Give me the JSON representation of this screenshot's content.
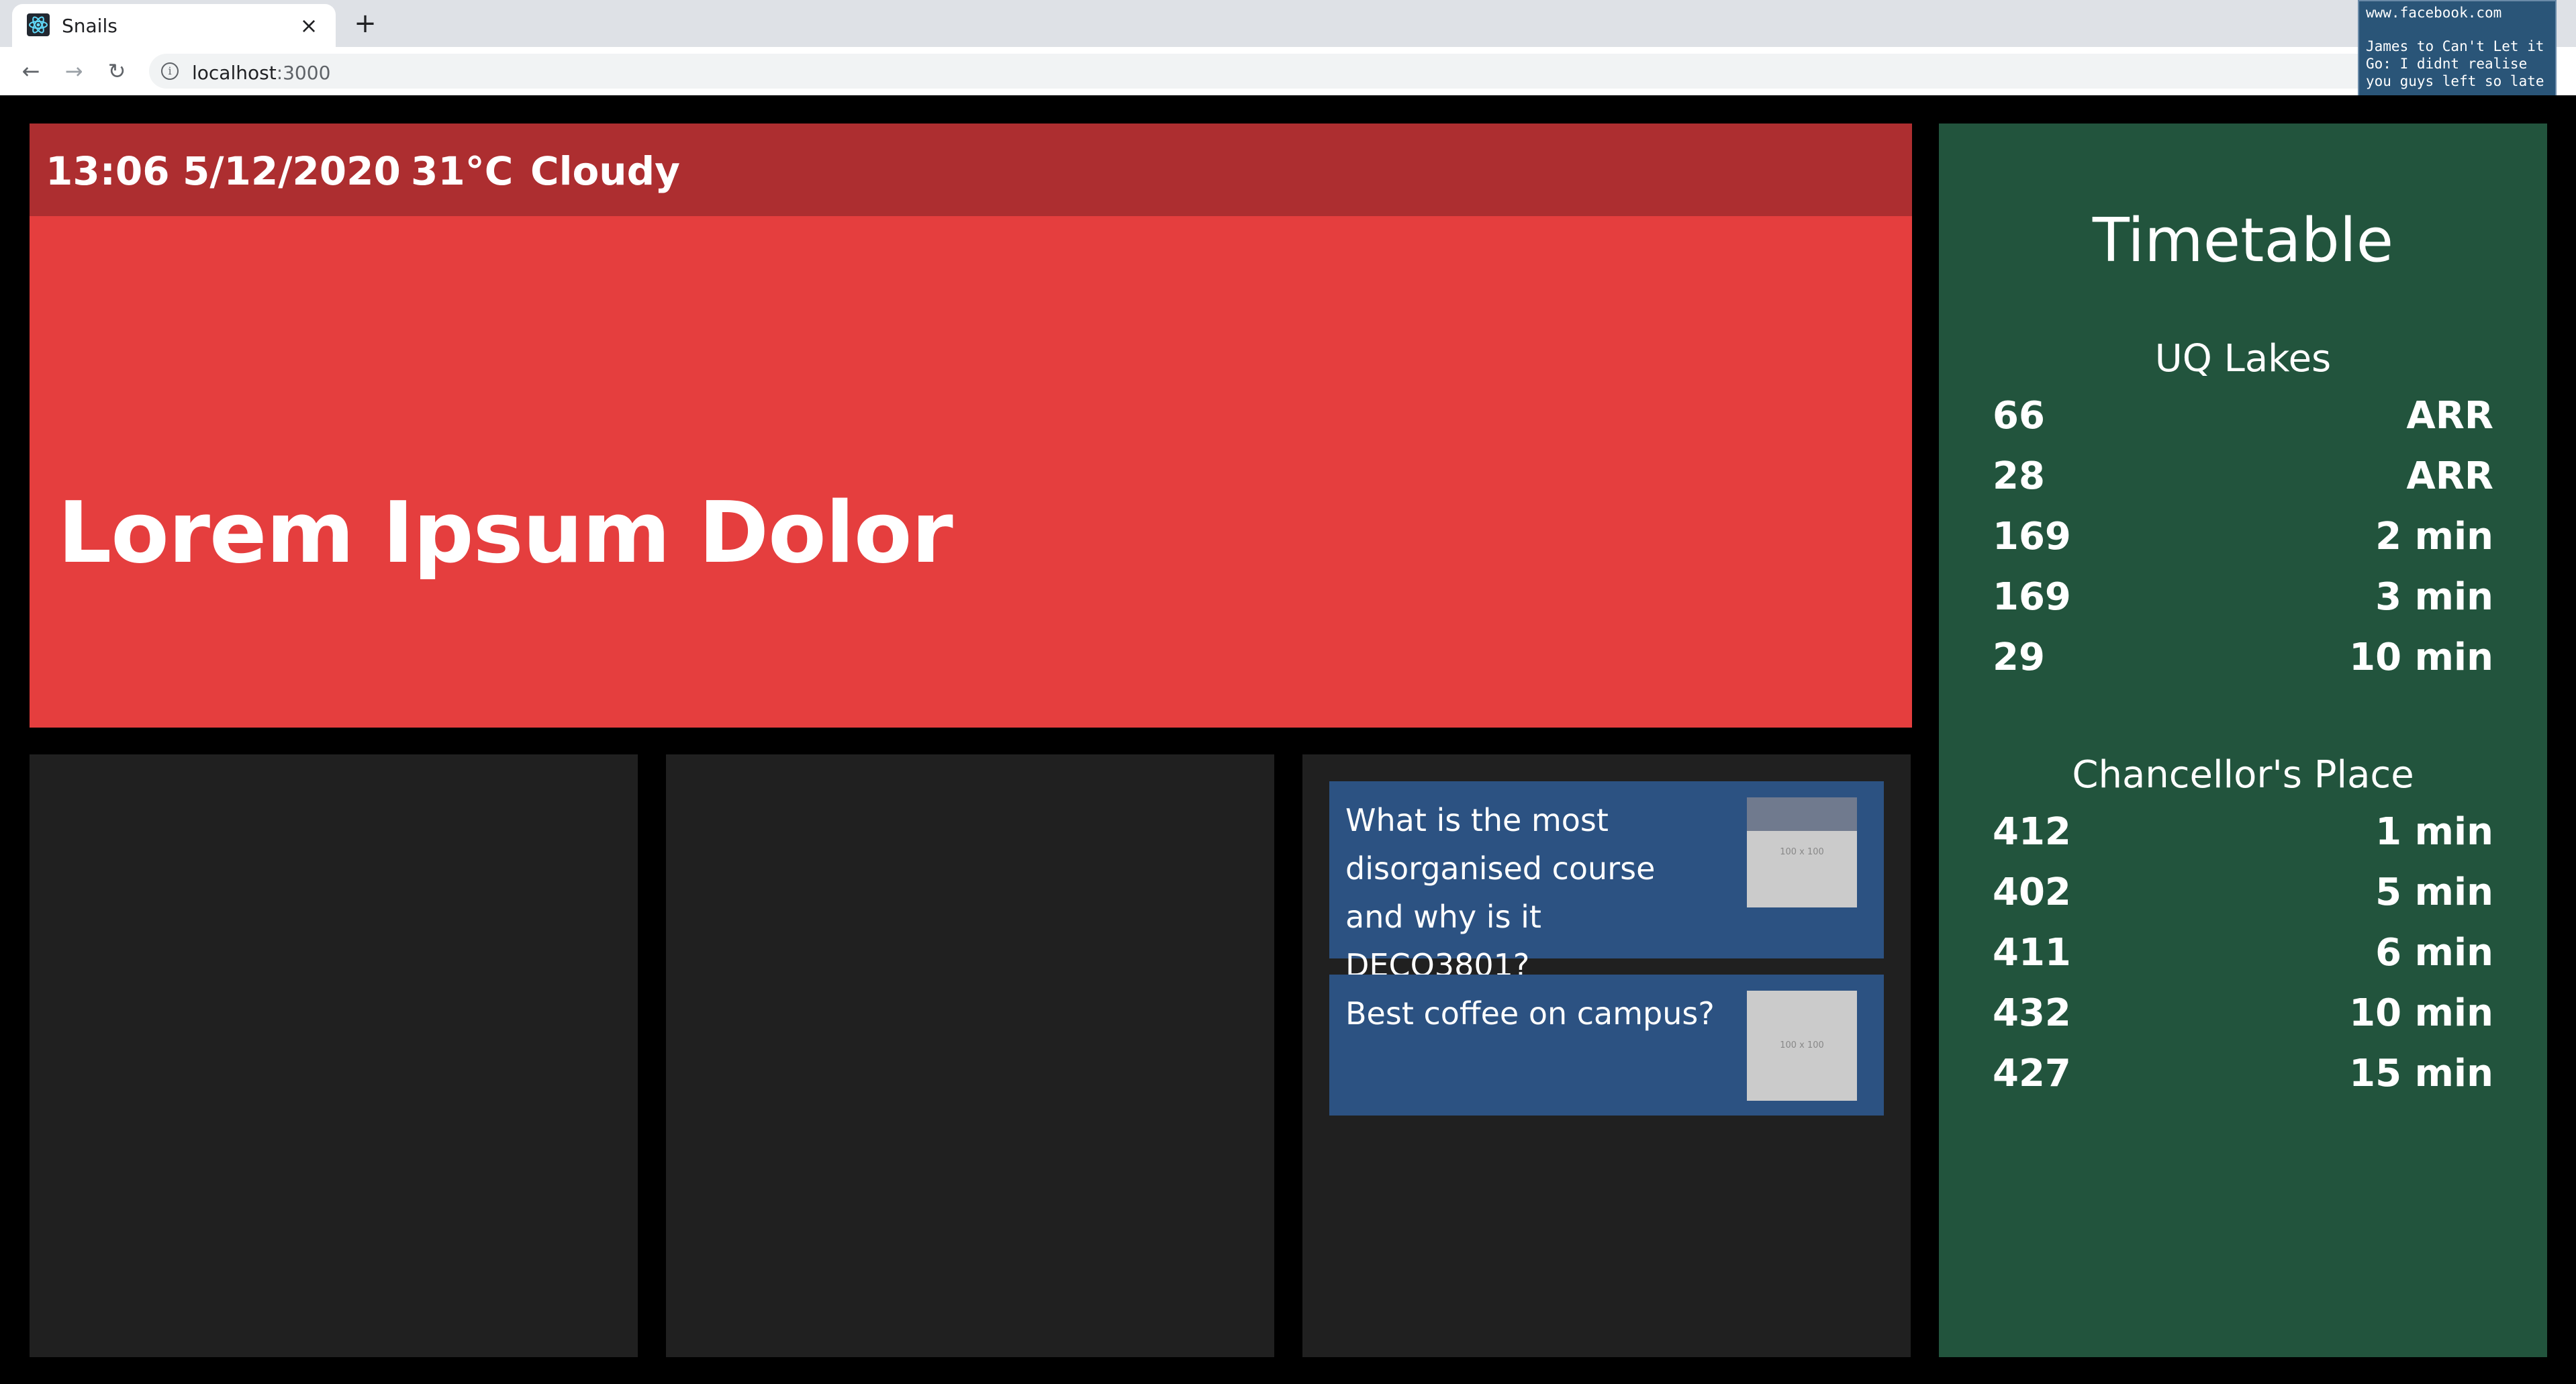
{
  "browser": {
    "tab_title": "Snails",
    "tab_close": "×",
    "new_tab": "+",
    "back": "←",
    "forward": "→",
    "reload": "↻",
    "info": "i",
    "url_host": "localhost",
    "url_port": ":3000"
  },
  "notification": {
    "title": "www.facebook.com",
    "body": "James to Can't Let it Go: I didnt realise you guys left so late"
  },
  "hero": {
    "time": "13:06",
    "date": "5/12/2020",
    "temperature": "31°C",
    "weather": "Cloudy",
    "title": "Lorem Ipsum Dolor"
  },
  "questions": [
    {
      "text": "What is the most disorganised course and why is it DECO3801?",
      "thumb_label": "100 x 100"
    },
    {
      "text": "Best coffee on campus?",
      "thumb_label": "100 x 100"
    }
  ],
  "timetable": {
    "title": "Timetable",
    "stops": [
      {
        "name": "UQ Lakes",
        "rows": [
          {
            "route": "66",
            "eta": "ARR"
          },
          {
            "route": "28",
            "eta": "ARR"
          },
          {
            "route": "169",
            "eta": "2 min"
          },
          {
            "route": "169",
            "eta": "3 min"
          },
          {
            "route": "29",
            "eta": "10 min"
          }
        ]
      },
      {
        "name": "Chancellor's Place",
        "rows": [
          {
            "route": "412",
            "eta": "1 min"
          },
          {
            "route": "402",
            "eta": "5 min"
          },
          {
            "route": "411",
            "eta": "6 min"
          },
          {
            "route": "432",
            "eta": "10 min"
          },
          {
            "route": "427",
            "eta": "15 min"
          }
        ]
      }
    ]
  },
  "colors": {
    "hero": "#e53e3e",
    "hero_header": "#ad2e30",
    "panel": "#202020",
    "card": "#2c5282",
    "timetable": "#22543d"
  }
}
